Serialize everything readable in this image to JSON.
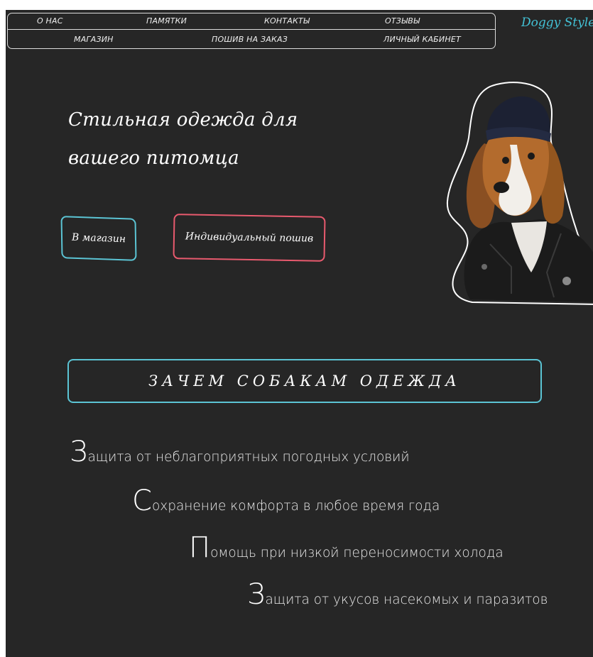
{
  "nav": {
    "row1": [
      "О НАС",
      "ПАМЯТКИ",
      "КОНТАКТЫ",
      "ОТЗЫВЫ"
    ],
    "row2": [
      "МАГАЗИН",
      "ПОШИВ НА ЗАКАЗ",
      "ЛИЧНЫЙ КАБИНЕТ"
    ]
  },
  "logo": "Doggy Style",
  "hero": {
    "title_line1": "Стильная одежда для",
    "title_line2": "вашего питомца",
    "btn_shop": "В магазин",
    "btn_custom": "Индивидуальный пошив",
    "image_alt": "beagle-in-beanie-and-leather-jacket"
  },
  "why_title": "ЗАЧЕМ СОБАКАМ ОДЕЖДА",
  "reasons": [
    {
      "cap": "З",
      "rest": "ащита от неблагоприятных погодных условий"
    },
    {
      "cap": "С",
      "rest": "охранение комфорта в любое время года"
    },
    {
      "cap": "П",
      "rest": "омощь при низкой переносимости холода"
    },
    {
      "cap": "З",
      "rest": "ащита от укусов насекомых и паразитов"
    }
  ],
  "colors": {
    "background": "#262626",
    "accent_blue": "#5bc4d4",
    "accent_pink": "#e85a6e",
    "logo": "#43c2d6"
  }
}
